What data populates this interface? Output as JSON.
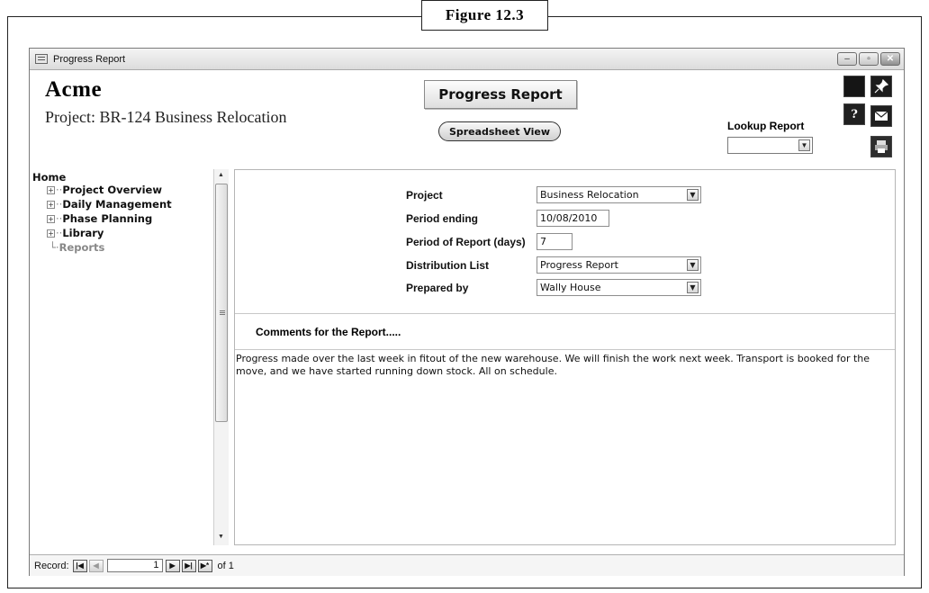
{
  "figure_caption": "Figure 12.3",
  "window": {
    "title": "Progress Report",
    "buttons": {
      "minimize": "–",
      "maximize": "▫",
      "close": "✕"
    }
  },
  "header": {
    "brand": "Acme",
    "project_line": "Project: BR-124 Business Relocation",
    "report_title": "Progress Report",
    "spreadsheet_button": "Spreadsheet View",
    "lookup_label": "Lookup Report",
    "lookup_value": ""
  },
  "toolbar_icons": [
    "blank-icon",
    "pin-icon",
    "help-icon",
    "mail-icon",
    "print-icon"
  ],
  "nav": {
    "home": "Home",
    "items": [
      {
        "label": "Project Overview",
        "expandable": true
      },
      {
        "label": "Daily Management",
        "expandable": true
      },
      {
        "label": "Phase Planning",
        "expandable": true
      },
      {
        "label": "Library",
        "expandable": true
      },
      {
        "label": "Reports",
        "expandable": false
      }
    ]
  },
  "form": {
    "fields": [
      {
        "label": "Project",
        "value": "Business Relocation",
        "type": "select"
      },
      {
        "label": "Period ending",
        "value": "10/08/2010",
        "type": "text"
      },
      {
        "label": "Period of Report (days)",
        "value": "7",
        "type": "text"
      },
      {
        "label": "Distribution List",
        "value": "Progress Report",
        "type": "select"
      },
      {
        "label": "Prepared by",
        "value": "Wally House",
        "type": "select"
      }
    ],
    "comments_heading": "Comments for the Report.....",
    "comments_text": "Progress made over the last week in fitout of the new warehouse.  We will finish the work next week.  Transport is booked for the move, and we have started running down stock.  All on schedule."
  },
  "record_nav": {
    "label": "Record:",
    "current": "1",
    "of_text": "of 1"
  }
}
